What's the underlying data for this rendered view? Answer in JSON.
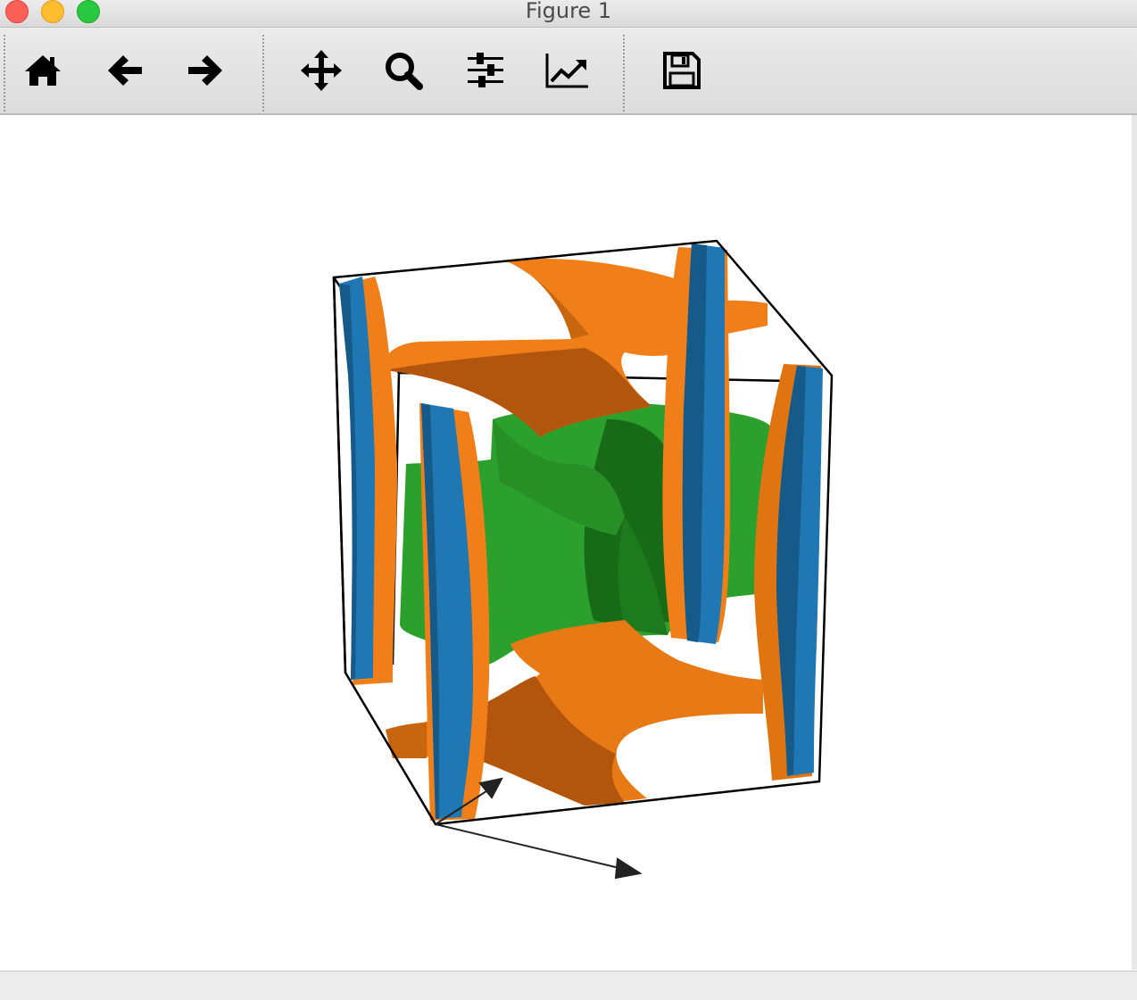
{
  "window": {
    "title": "Figure 1",
    "controls": [
      {
        "name": "close",
        "color": "#fe5f57"
      },
      {
        "name": "minimize",
        "color": "#febc2e"
      },
      {
        "name": "zoom",
        "color": "#28c840"
      }
    ]
  },
  "toolbar": {
    "buttons": [
      {
        "name": "home",
        "icon": "home-icon"
      },
      {
        "name": "back",
        "icon": "arrow-left-icon"
      },
      {
        "name": "forward",
        "icon": "arrow-right-icon"
      },
      {
        "name": "pan",
        "icon": "move-icon"
      },
      {
        "name": "zoom",
        "icon": "magnifier-icon"
      },
      {
        "name": "configure-subplots",
        "icon": "sliders-icon"
      },
      {
        "name": "edit-axes",
        "icon": "chart-line-icon"
      },
      {
        "name": "save",
        "icon": "floppy-disk-icon"
      }
    ]
  },
  "figure": {
    "type": "3d isosurface plot",
    "colors": {
      "surface_a": "#1f77b4",
      "surface_b": "#ff7f0e",
      "surface_c": "#2ca02c",
      "box": "#000000"
    },
    "status_text": ""
  }
}
